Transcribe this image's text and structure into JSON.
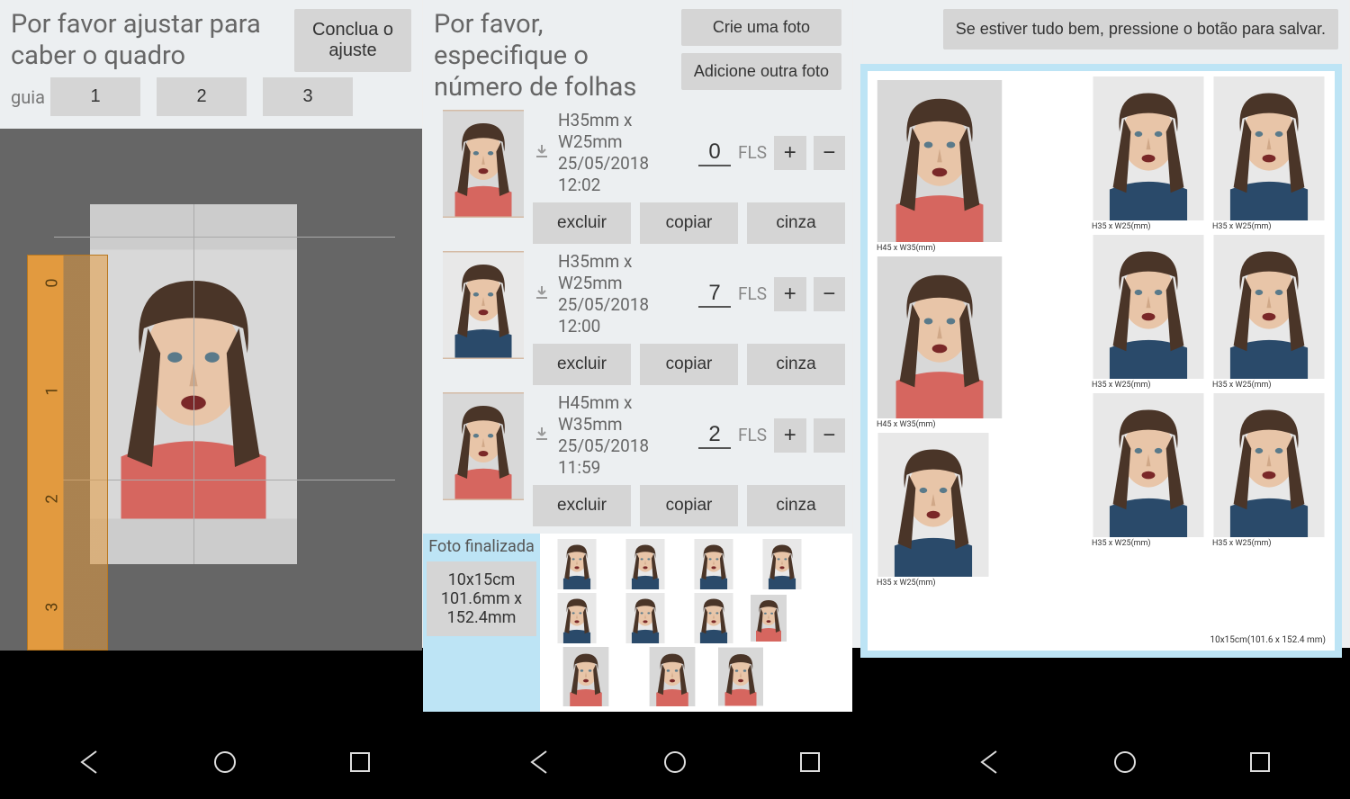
{
  "screen1": {
    "title": "Por favor ajustar para caber o quadro",
    "complete_btn": "Conclua o ajuste",
    "guide_label": "guia",
    "guide_buttons": [
      "1",
      "2",
      "3"
    ],
    "ruler_labels": [
      "0",
      "1",
      "2",
      "3"
    ]
  },
  "screen2": {
    "title": "Por favor, especifique o número de folhas",
    "create_btn": "Crie uma foto",
    "add_btn": "Adicione outra foto",
    "fls_label": "FLS",
    "items": [
      {
        "dims": "H35mm x W25mm",
        "date": "25/05/2018 12:02",
        "qty": "0",
        "delete": "excluir",
        "copy": "copiar",
        "gray": "cinza"
      },
      {
        "dims": "H35mm x W25mm",
        "date": "25/05/2018 12:00",
        "qty": "7",
        "delete": "excluir",
        "copy": "copiar",
        "gray": "cinza"
      },
      {
        "dims": "H45mm x W35mm",
        "date": "25/05/2018 11:59",
        "qty": "2",
        "delete": "excluir",
        "copy": "copiar",
        "gray": "cinza"
      }
    ],
    "foto_finalizada": "Foto finalizada",
    "final_dims": "10x15cm 101.6mm x 152.4mm"
  },
  "screen3": {
    "save_btn": "Se estiver tudo bem, pressione o botão para salvar.",
    "tile_label_lg": "H45 x W35(mm)",
    "tile_label_sm": "H35 x W25(mm)",
    "sheet_label": "10x15cm(101.6 x 152.4 mm)"
  }
}
